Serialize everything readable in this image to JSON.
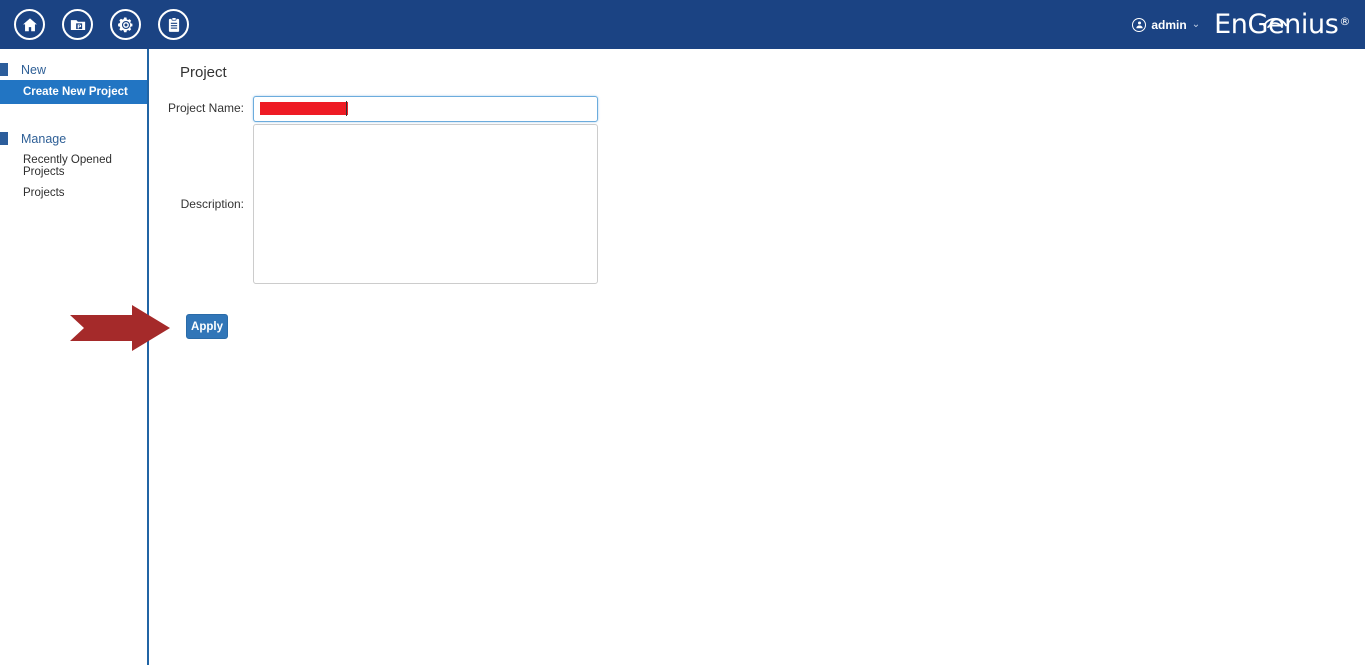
{
  "header": {
    "icons": [
      {
        "name": "home-icon",
        "label": "Home"
      },
      {
        "name": "projects-icon",
        "label": "Projects"
      },
      {
        "name": "gear-icon",
        "label": "Settings"
      },
      {
        "name": "clipboard-icon",
        "label": "Reports"
      }
    ],
    "user": {
      "icon": "user-icon",
      "name": "admin",
      "caret": "⌄"
    },
    "brand": {
      "text": "EnGenius",
      "registered": "®",
      "wifi_icon": "wifi-arc-icon"
    },
    "background_color": "#1b4383"
  },
  "sidebar": {
    "sections": [
      {
        "label": "New",
        "items": [
          {
            "label": "Create New Project",
            "active": true
          }
        ]
      },
      {
        "label": "Manage",
        "items": [
          {
            "label": "Recently Opened Projects",
            "active": false
          },
          {
            "label": "Projects",
            "active": false
          }
        ]
      }
    ],
    "active_color": "#2275c3",
    "section_color": "#2e5f96",
    "border_color": "#2164a4"
  },
  "main": {
    "title": "Project",
    "fields": {
      "project_name": {
        "label": "Project Name:",
        "value": "",
        "placeholder": "",
        "redacted": true,
        "redaction_color": "#ee1b24",
        "focused": true
      },
      "description": {
        "label": "Description:",
        "value": "",
        "placeholder": ""
      }
    },
    "apply_button": {
      "label": "Apply",
      "color": "#3176b8"
    }
  },
  "annotation": {
    "arrow": {
      "name": "red-arrow-annotation",
      "color": "#a52a2a",
      "direction": "right",
      "points_to": "Apply"
    }
  }
}
